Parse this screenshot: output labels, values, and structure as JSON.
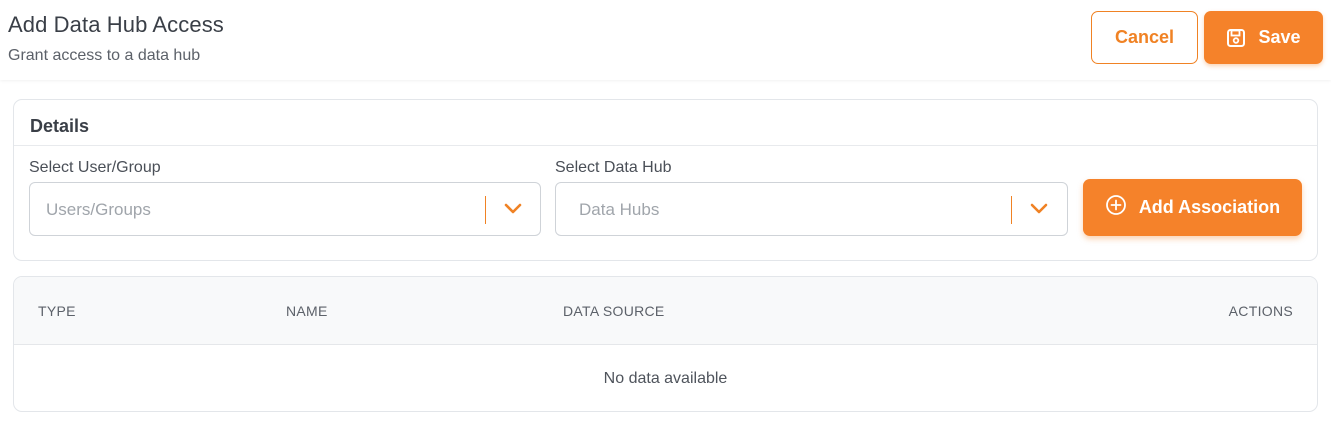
{
  "header": {
    "title": "Add Data Hub Access",
    "subtitle": "Grant access to a data hub",
    "cancel_label": "Cancel",
    "save_label": "Save"
  },
  "details": {
    "title": "Details",
    "user_group": {
      "label": "Select User/Group",
      "placeholder": "Users/Groups",
      "value": ""
    },
    "data_hub": {
      "label": "Select Data Hub",
      "placeholder": "Data Hubs",
      "value": ""
    },
    "add_label": "Add Association"
  },
  "table": {
    "columns": [
      "TYPE",
      "NAME",
      "DATA SOURCE",
      "ACTIONS"
    ],
    "rows": [],
    "empty_text": "No data available"
  },
  "icons": {
    "save": "floppy-disk-icon",
    "add": "plus-circle-icon",
    "dropdown": "chevron-down-icon"
  },
  "colors": {
    "accent": "#f5822a",
    "accent_border": "#f08224",
    "border": "#cfd3d8",
    "table_header_bg": "#f8f9fa"
  }
}
